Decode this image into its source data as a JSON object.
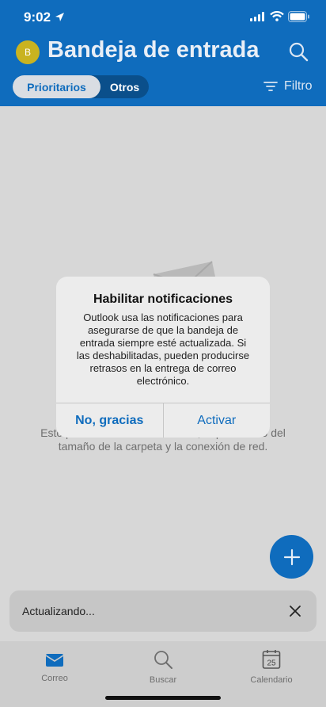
{
  "status_bar": {
    "time": "9:02"
  },
  "header": {
    "avatar_initial": "B",
    "title": "Bandeja de entrada",
    "tabs": [
      "Prioritarios",
      "Otros"
    ],
    "filter_label": "Filtro"
  },
  "dialog": {
    "title": "Habilitar notificaciones",
    "message": "Outlook usa las notificaciones para asegurarse de que la bandeja de entrada siempre esté actualizada. Si las deshabilitadas, pueden producirse retrasos en la entrega de correo electrónico.",
    "cancel_label": "No, gracias",
    "confirm_label": "Activar"
  },
  "empty_state": {
    "text": "Esto puede tardar unos minutos, dependiendo del tamaño de la carpeta y la conexión de red."
  },
  "snackbar": {
    "text": "Actualizando..."
  },
  "tabbar": {
    "items": [
      {
        "label": "Correo",
        "icon": "mail-icon"
      },
      {
        "label": "Buscar",
        "icon": "search-icon"
      },
      {
        "label": "Calendario",
        "icon": "calendar-icon",
        "day": "25"
      }
    ]
  },
  "colors": {
    "brand": "#0f6cbd",
    "overlay_bg": "#d7d7d7"
  }
}
